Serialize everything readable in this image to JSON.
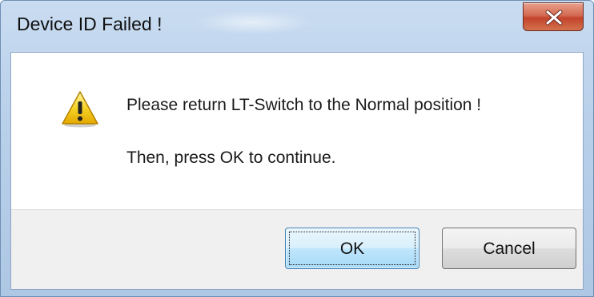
{
  "window": {
    "title": "Device ID Failed !"
  },
  "titlebar": {
    "close_icon": "close-x-icon",
    "close_color": "#c7452c"
  },
  "message": {
    "icon": "warning-icon",
    "line1": "Please return LT-Switch to the Normal position !",
    "line2": "Then, press OK to continue."
  },
  "buttons": {
    "ok_label": "OK",
    "cancel_label": "Cancel"
  },
  "colors": {
    "titlebar": "#b9d0ea",
    "footer": "#f0f0f0",
    "ok_focus": "#3c7fb1"
  }
}
